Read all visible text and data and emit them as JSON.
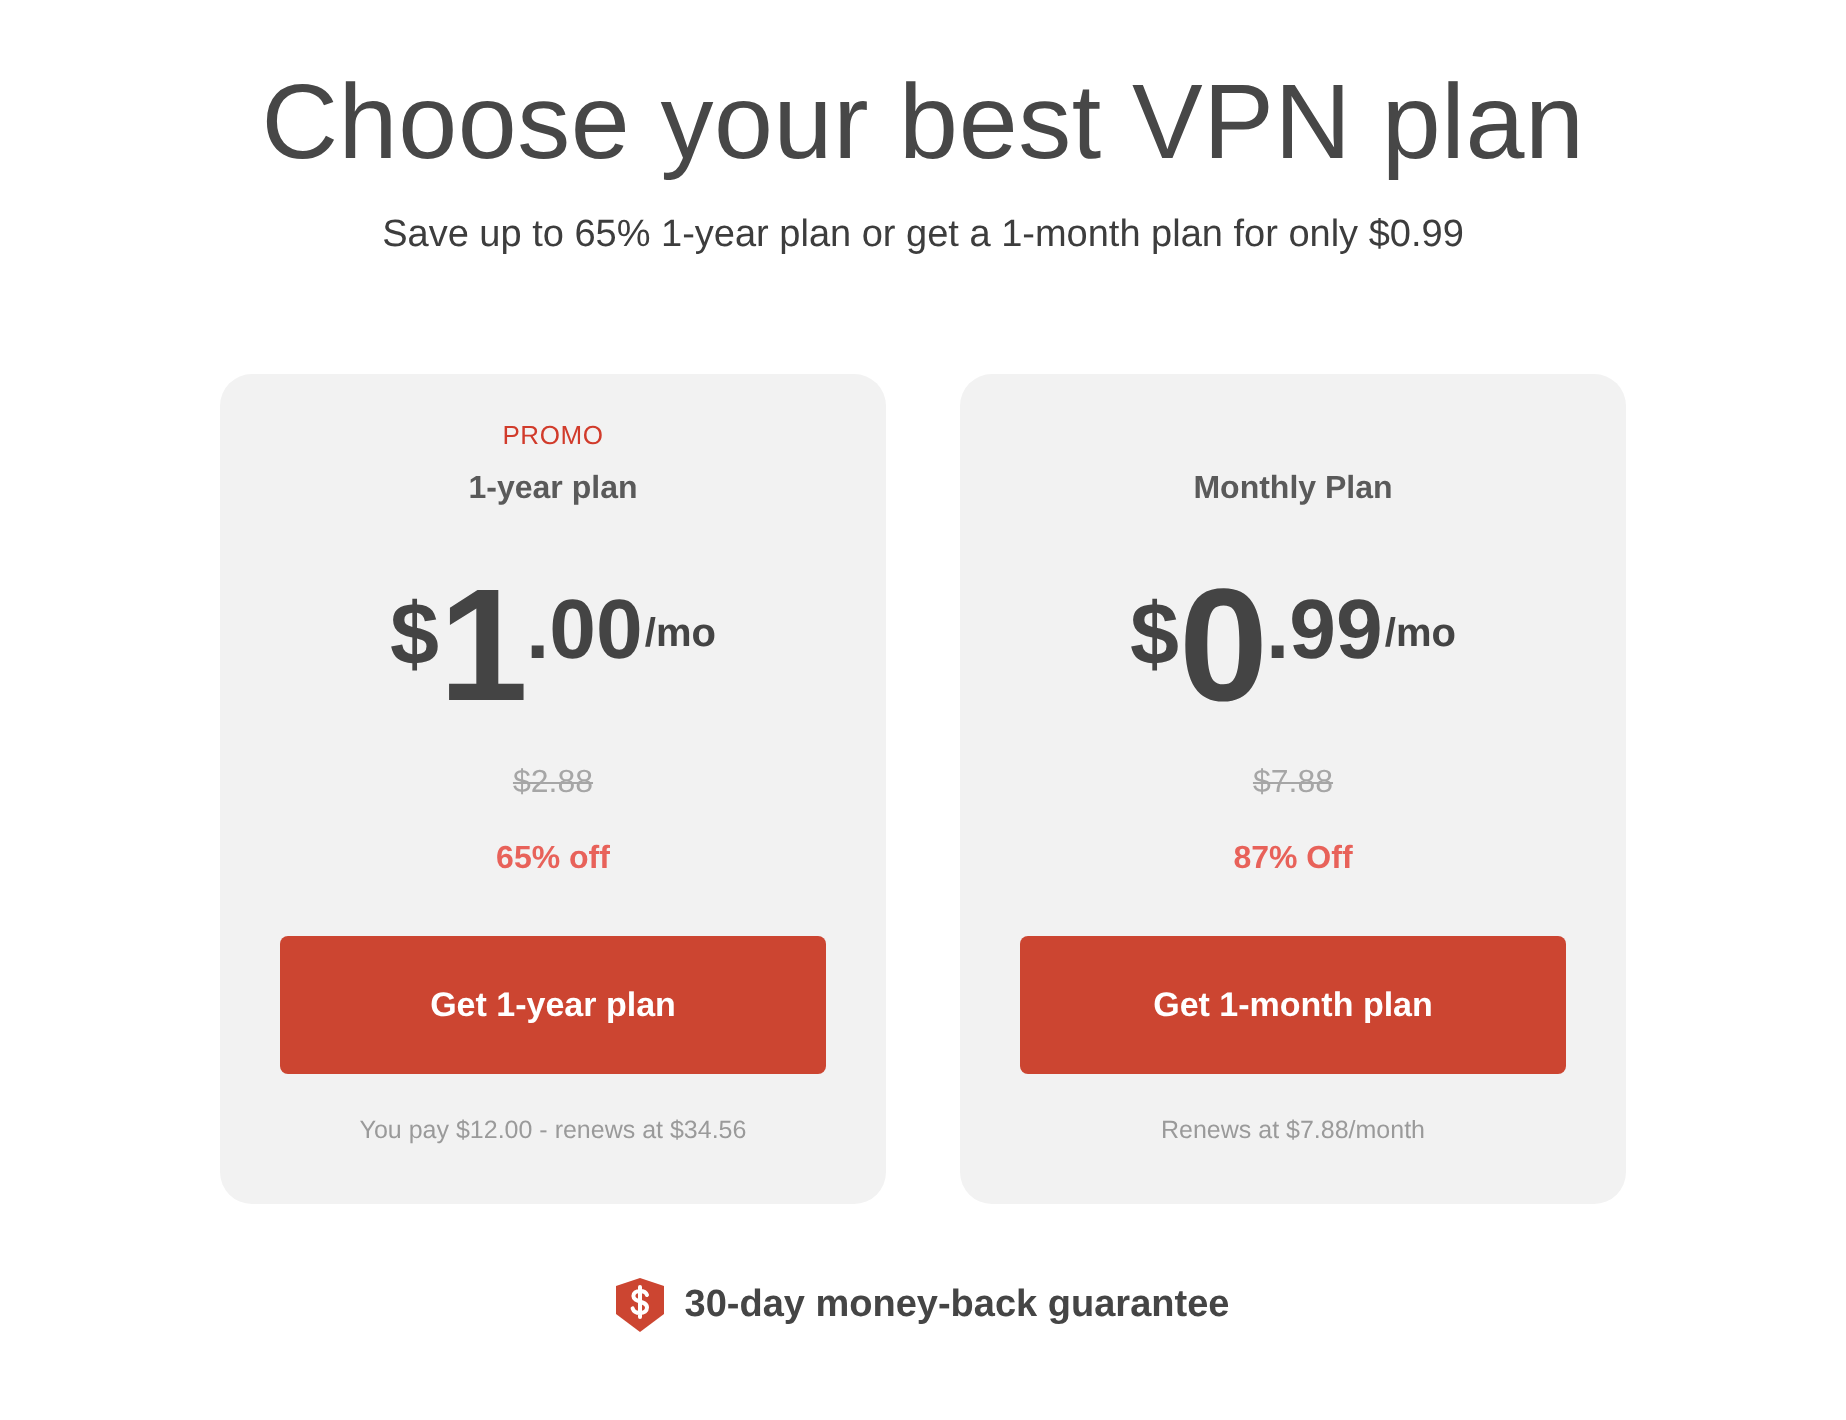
{
  "header": {
    "title": "Choose your best VPN plan",
    "subtitle": "Save up to 65% 1-year plan or get a 1-month plan for only $0.99"
  },
  "plans": [
    {
      "badge": "PROMO",
      "name": "1-year plan",
      "price": {
        "currency": "$",
        "whole": "1",
        "cents": ".00",
        "period": "/mo"
      },
      "old_price": "$2.88",
      "discount": "65% off",
      "button": "Get 1-year plan",
      "note": "You pay $12.00 - renews at $34.56"
    },
    {
      "name": "Monthly Plan",
      "price": {
        "currency": "$",
        "whole": "0",
        "cents": ".99",
        "period": "/mo"
      },
      "old_price": "$7.88",
      "discount": "87% Off",
      "button": "Get 1-month plan",
      "note": "Renews at $7.88/month"
    }
  ],
  "guarantee": {
    "text": "30-day money-back guarantee"
  }
}
